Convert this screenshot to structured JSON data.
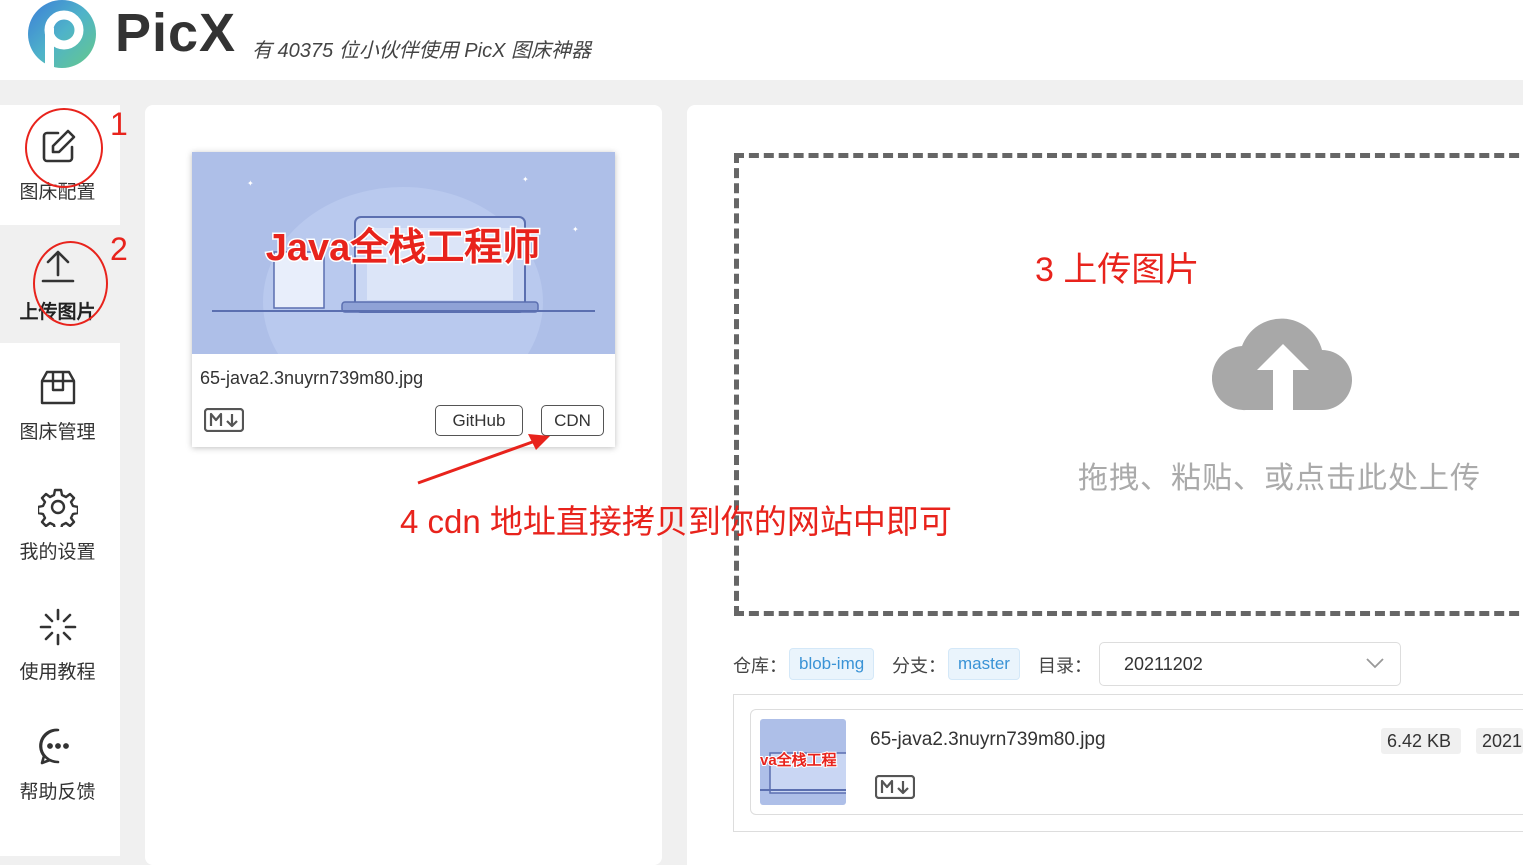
{
  "header": {
    "brand": "PicX",
    "tagline": "有 40375 位小伙伴使用 PicX 图床神器"
  },
  "sidebar": {
    "items": [
      {
        "label": "图床配置",
        "icon": "edit-icon"
      },
      {
        "label": "上传图片",
        "icon": "upload-arrow-icon",
        "active": true
      },
      {
        "label": "图床管理",
        "icon": "package-icon"
      },
      {
        "label": "我的设置",
        "icon": "gear-icon"
      },
      {
        "label": "使用教程",
        "icon": "sparkle-icon"
      },
      {
        "label": "帮助反馈",
        "icon": "chat-bubble-icon"
      }
    ]
  },
  "uploaded_card": {
    "image_title": "Java全栈工程师",
    "filename": "65-java2.3nuyrn739m80.jpg",
    "buttons": {
      "github": "GitHub",
      "cdn": "CDN"
    }
  },
  "dropzone": {
    "text": "拖拽、粘贴、或点击此处上传"
  },
  "meta": {
    "repo_label": "仓库：",
    "repo": "blob-img",
    "branch_label": "分支：",
    "branch": "master",
    "dir_label": "目录：",
    "dir": "20211202"
  },
  "list": {
    "items": [
      {
        "thumb_text": "va全栈工程",
        "filename": "65-java2.3nuyrn739m80.jpg",
        "size": "6.42 KB",
        "date": "2021"
      }
    ]
  },
  "annotations": {
    "n1": "1",
    "n2": "2",
    "n3": "3 上传图片",
    "n4": "4 cdn 地址直接拷贝到你的网站中即可"
  },
  "colors": {
    "annotation": "#e8231c",
    "tag_text": "#3a93d6",
    "image_bg": "#aebfe8"
  }
}
